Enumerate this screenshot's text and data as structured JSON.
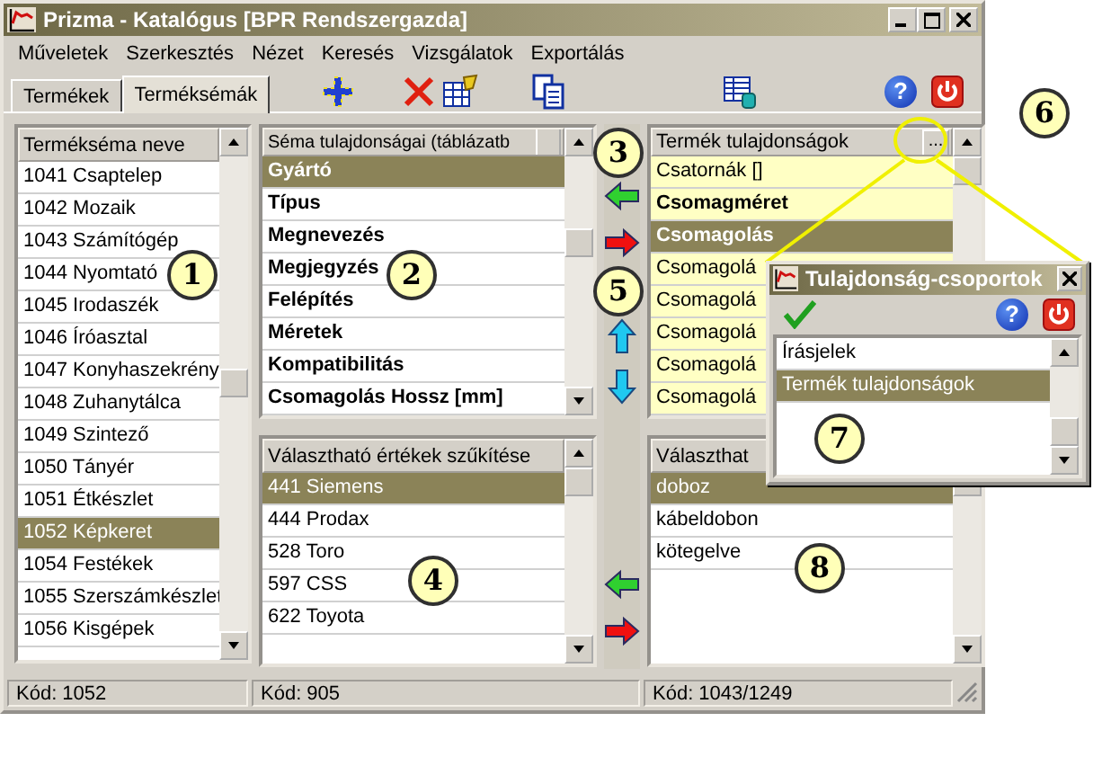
{
  "window": {
    "title": "Prizma - Katalógus [BPR Rendszergazda]"
  },
  "menu": [
    "Műveletek",
    "Szerkesztés",
    "Nézet",
    "Keresés",
    "Vizsgálatok",
    "Exportálás"
  ],
  "tabs": [
    {
      "label": "Termékek",
      "selected": false
    },
    {
      "label": "Terméksémák",
      "selected": true
    }
  ],
  "toolbar": {
    "help": "?"
  },
  "schema_list": {
    "header": "Termékséma neve",
    "rows": [
      {
        "text": "1041 Csaptelep",
        "selected": false
      },
      {
        "text": "1042 Mozaik",
        "selected": false
      },
      {
        "text": "1043 Számítógép",
        "selected": false
      },
      {
        "text": "1044 Nyomtató",
        "selected": false
      },
      {
        "text": "1045 Irodaszék",
        "selected": false
      },
      {
        "text": "1046 Íróasztal",
        "selected": false
      },
      {
        "text": "1047 Konyhaszekrény",
        "selected": false
      },
      {
        "text": "1048 Zuhanytálca",
        "selected": false
      },
      {
        "text": "1049 Szintező",
        "selected": false
      },
      {
        "text": "1050 Tányér",
        "selected": false
      },
      {
        "text": "1051 Étkészlet",
        "selected": false
      },
      {
        "text": "1052 Képkeret",
        "selected": true
      },
      {
        "text": "1054 Festékek",
        "selected": false
      },
      {
        "text": "1055 Szerszámkészlet",
        "selected": false
      },
      {
        "text": "1056 Kisgépek",
        "selected": false
      }
    ]
  },
  "schema_properties": {
    "header": "Séma tulajdonságai (táblázatb",
    "rows": [
      {
        "text": "Gyártó",
        "selected": true
      },
      {
        "text": "Típus",
        "selected": false
      },
      {
        "text": "Megnevezés",
        "selected": false
      },
      {
        "text": "Megjegyzés",
        "selected": false
      },
      {
        "text": "Felépítés",
        "selected": false
      },
      {
        "text": "Méretek",
        "selected": false
      },
      {
        "text": "Kompatibilitás",
        "selected": false
      },
      {
        "text": "Csomagolás Hossz [mm]",
        "selected": false
      }
    ]
  },
  "value_filter": {
    "header": "Választható értékek szűkítése",
    "rows": [
      {
        "text": "441 Siemens",
        "selected": true
      },
      {
        "text": "444 Prodax",
        "selected": false
      },
      {
        "text": "528 Toro",
        "selected": false
      },
      {
        "text": "597 CSS",
        "selected": false
      },
      {
        "text": "622 Toyota",
        "selected": false
      }
    ]
  },
  "product_properties": {
    "header": "Termék tulajdonságok",
    "button": "...",
    "rows": [
      {
        "text": "Csatornák []",
        "bold": false,
        "selected": false
      },
      {
        "text": "Csomagméret",
        "bold": true,
        "selected": false
      },
      {
        "text": "Csomagolás",
        "bold": true,
        "selected": true
      },
      {
        "text": "Csomagolá",
        "bold": false,
        "selected": false
      },
      {
        "text": "Csomagolá",
        "bold": false,
        "selected": false
      },
      {
        "text": "Csomagolá",
        "bold": false,
        "selected": false
      },
      {
        "text": "Csomagolá",
        "bold": false,
        "selected": false
      },
      {
        "text": "Csomagolá",
        "bold": false,
        "selected": false
      }
    ]
  },
  "available_values": {
    "header": "Választhat",
    "rows": [
      {
        "text": "doboz",
        "selected": true
      },
      {
        "text": "kábeldobon",
        "selected": false
      },
      {
        "text": "kötegelve",
        "selected": false
      }
    ]
  },
  "status_bar": [
    "Kód: 1052",
    "Kód: 905",
    "Kód: 1043/1249"
  ],
  "dialog": {
    "title": "Tulajdonság-csoportok",
    "help": "?",
    "rows": [
      {
        "text": "Írásjelek",
        "selected": false
      },
      {
        "text": "Termék tulajdonságok",
        "selected": true
      }
    ]
  },
  "callouts": [
    "1",
    "2",
    "3",
    "4",
    "5",
    "6",
    "7",
    "8"
  ]
}
